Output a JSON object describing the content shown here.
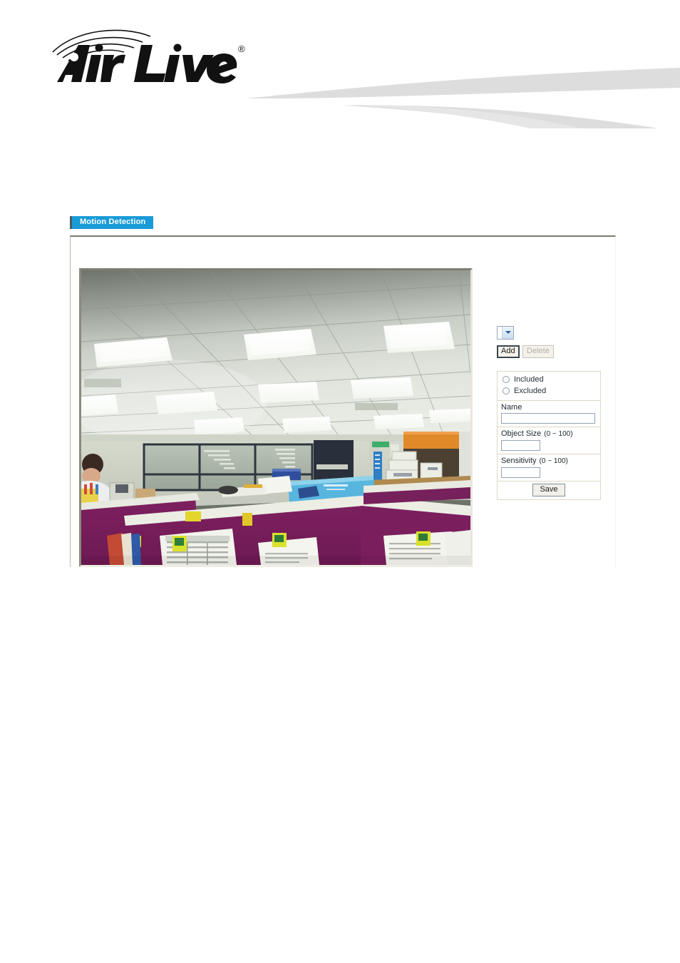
{
  "brand": {
    "name": "Air Live",
    "trademark": "®",
    "logo_icon": "airlive-wifi-waves-logo"
  },
  "tabs": [
    {
      "label": "Motion Detection",
      "active": true,
      "color": "#199bd7"
    }
  ],
  "video": {
    "alt": "Live camera preview of office ceiling with fluorescent panel lights and purple cubicle partitions",
    "icon": "video-preview"
  },
  "controls": {
    "window_select": {
      "value": "",
      "icon": "chevron-down-icon",
      "options": []
    },
    "add_label": "Add",
    "delete_label": "Delete",
    "delete_disabled": true
  },
  "settings": {
    "mode": {
      "included_label": "Included",
      "excluded_label": "Excluded",
      "selected": ""
    },
    "name": {
      "label": "Name",
      "value": "",
      "placeholder": ""
    },
    "object_size": {
      "label": "Object Size",
      "range": "(0 ~ 100)",
      "value": "",
      "placeholder": ""
    },
    "sensitivity": {
      "label": "Sensitivity",
      "range": "(0 ~ 100)",
      "value": "",
      "placeholder": ""
    },
    "save_label": "Save"
  },
  "colors": {
    "tab_blue": "#199bd7",
    "swoosh_gray": "#dddddd",
    "panel_border": "#ded7c4",
    "input_border": "#93a3b4"
  }
}
